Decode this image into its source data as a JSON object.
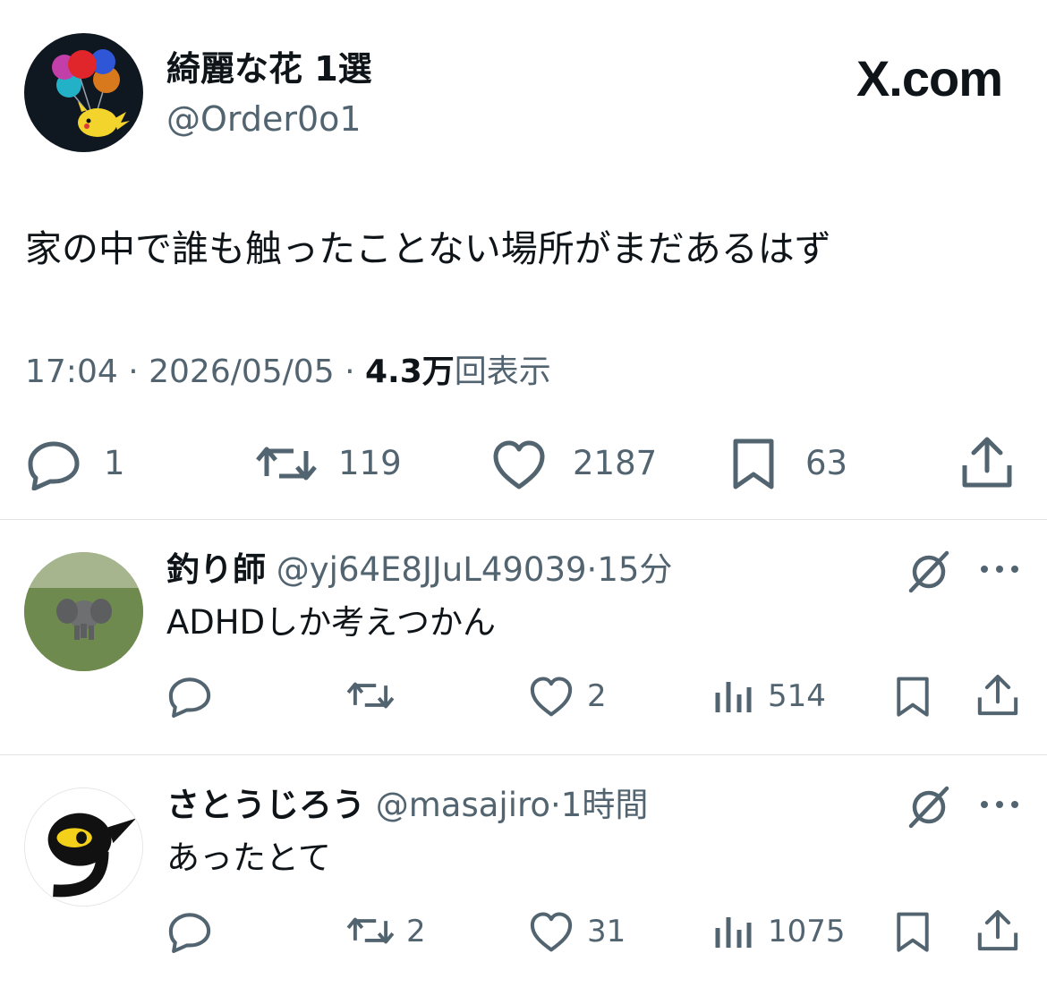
{
  "brand": {
    "logo_text": "X.com"
  },
  "tweet": {
    "author": {
      "name": "綺麗な花 1選",
      "handle": "@Order0o1"
    },
    "text": "家の中で誰も触ったことない場所がまだあるはず",
    "time": "17:04",
    "sep1": "·",
    "date": "2026/05/05",
    "sep2": "·",
    "views_count": "4.3万",
    "views_label": "回表示",
    "actions": {
      "replies": "1",
      "reposts": "119",
      "likes": "2187",
      "bookmarks": "63"
    }
  },
  "replies": [
    {
      "name": "釣り師",
      "handle": "@yj64E8JJuL49039",
      "sep": "·",
      "time": "15分",
      "text": "ADHDしか考えつかん",
      "actions": {
        "reposts": "",
        "likes": "2",
        "views": "514"
      }
    },
    {
      "name": "さとうじろう",
      "handle": "@masajiro",
      "sep": "·",
      "time": "1時間",
      "text": "あったとて",
      "actions": {
        "reposts": "2",
        "likes": "31",
        "views": "1075"
      }
    }
  ],
  "icons": {
    "reply": "speech-bubble-icon",
    "repost": "repost-arrows-icon",
    "like": "heart-icon",
    "bookmark": "bookmark-icon",
    "share": "share-upload-icon",
    "views": "bar-chart-icon",
    "grok": "grok-slash-icon",
    "more": "ellipsis-icon"
  },
  "colors": {
    "text": "#0f1419",
    "secondary": "#536471",
    "divider": "#e1e5e8",
    "background": "#ffffff"
  }
}
